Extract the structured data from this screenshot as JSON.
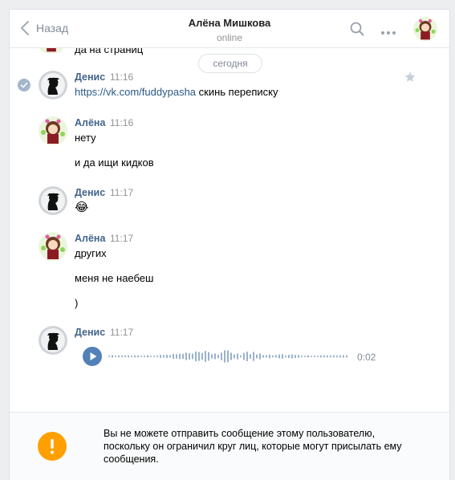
{
  "header": {
    "back_label": "Назад",
    "title": "Алёна Мишкова",
    "status": "online"
  },
  "history": {
    "partial_text": "да на страниц",
    "date_divider": "сегодня",
    "messages": [
      {
        "author": "Денис",
        "time": "11:16",
        "link": "https://vk.com/fuddypasha",
        "text": " скинь переписку",
        "read_check": "check-icon",
        "favorite": "star-icon"
      },
      {
        "author": "Алёна",
        "time": "11:16",
        "lines": [
          "нету",
          "и да ищи кидков"
        ]
      },
      {
        "author": "Денис",
        "time": "11:17",
        "emoji": "😂"
      },
      {
        "author": "Алёна",
        "time": "11:17",
        "lines": [
          "других",
          "меня не наебеш",
          ")"
        ]
      },
      {
        "author": "Денис",
        "time": "11:17",
        "audio": {
          "duration": "0:02",
          "play_icon": "play-icon"
        }
      }
    ]
  },
  "footer": {
    "notice": "Вы не можете отправить сообщение этому пользователю, поскольку он ограничил круг лиц, которые могут присылать ему сообщения.",
    "icon": "exclamation-icon"
  },
  "colors": {
    "link": "#2a5885",
    "author": "#42648b",
    "accent": "#5181b8",
    "warning": "#ffa000",
    "muted": "#828a99"
  }
}
